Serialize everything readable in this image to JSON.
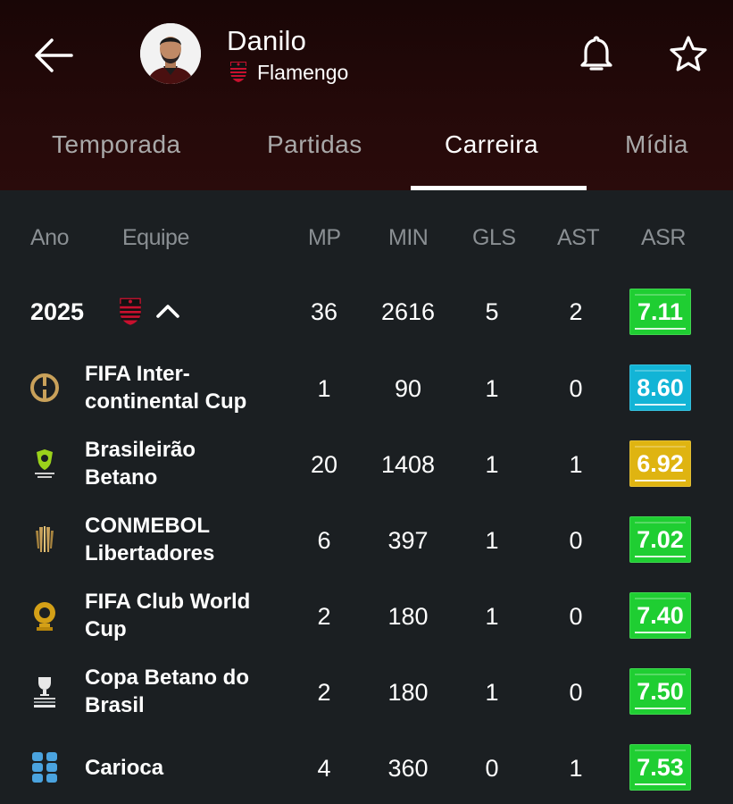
{
  "header": {
    "player_name": "Danilo",
    "club_name": "Flamengo",
    "back_icon": "arrow-left-icon",
    "bell_icon": "bell-icon",
    "star_icon": "star-icon"
  },
  "tabs": [
    {
      "label": "Temporada"
    },
    {
      "label": "Partidas"
    },
    {
      "label": "Carreira",
      "active": true
    },
    {
      "label": "Mídia"
    }
  ],
  "table": {
    "columns": [
      "Ano",
      "Equipe",
      "MP",
      "MIN",
      "GLS",
      "AST",
      "ASR"
    ],
    "season": {
      "year": "2025",
      "mp": "36",
      "min": "2616",
      "gls": "5",
      "ast": "2",
      "asr": "7.11",
      "color": "#1fce32"
    },
    "rows": [
      {
        "line1": "FIFA Inter-",
        "line2": "continental Cup",
        "mp": "1",
        "min": "90",
        "gls": "1",
        "ast": "0",
        "asr": "8.60",
        "color": "#12b4d6",
        "icon": "fifa-intercontinental-cup-icon"
      },
      {
        "line1": "Brasileirão",
        "line2": "Betano",
        "mp": "20",
        "min": "1408",
        "gls": "1",
        "ast": "1",
        "asr": "6.92",
        "color": "#dfb411",
        "icon": "brasileirao-icon"
      },
      {
        "line1": "CONMEBOL",
        "line2": "Libertadores",
        "mp": "6",
        "min": "397",
        "gls": "1",
        "ast": "0",
        "asr": "7.02",
        "color": "#1fce32",
        "icon": "libertadores-trophy-icon"
      },
      {
        "line1": "FIFA Club World",
        "line2": "Cup",
        "mp": "2",
        "min": "180",
        "gls": "1",
        "ast": "0",
        "asr": "7.40",
        "color": "#1fce32",
        "icon": "club-world-cup-icon"
      },
      {
        "line1": "Copa Betano do",
        "line2": "Brasil",
        "mp": "2",
        "min": "180",
        "gls": "1",
        "ast": "0",
        "asr": "7.50",
        "color": "#1fce32",
        "icon": "copa-do-brasil-icon"
      },
      {
        "line1": "Carioca",
        "line2": "",
        "mp": "4",
        "min": "360",
        "gls": "0",
        "ast": "1",
        "asr": "7.53",
        "color": "#1fce32",
        "icon": "carioca-icon"
      }
    ]
  }
}
